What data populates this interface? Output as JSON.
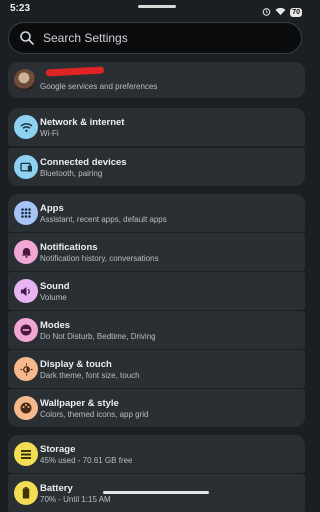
{
  "status_bar": {
    "time": "5:23",
    "alarm_icon": "alarm-icon",
    "wifi_icon": "wifi-icon",
    "battery": "70"
  },
  "search": {
    "placeholder": "Search Settings"
  },
  "account": {
    "name": "",
    "subtitle": "Google services and preferences"
  },
  "groups": [
    {
      "items": [
        {
          "title": "Network & internet",
          "subtitle": "Wi-Fi",
          "icon": "wifi-icon",
          "color": "#8fd1f2"
        },
        {
          "title": "Connected devices",
          "subtitle": "Bluetooth, pairing",
          "icon": "devices-icon",
          "color": "#8fd1f2"
        }
      ]
    },
    {
      "items": [
        {
          "title": "Apps",
          "subtitle": "Assistant, recent apps, default apps",
          "icon": "apps-icon",
          "color": "#a8c4f6"
        },
        {
          "title": "Notifications",
          "subtitle": "Notification history, conversations",
          "icon": "bell-icon",
          "color": "#f0a7d6"
        },
        {
          "title": "Sound",
          "subtitle": "Volume",
          "icon": "volume-icon",
          "color": "#e9b3f3"
        },
        {
          "title": "Modes",
          "subtitle": "Do Not Disturb, Bedtime, Driving",
          "icon": "do-not-disturb-icon",
          "color": "#f0a7d6"
        },
        {
          "title": "Display & touch",
          "subtitle": "Dark theme, font size, touch",
          "icon": "brightness-icon",
          "color": "#f5b98d"
        },
        {
          "title": "Wallpaper & style",
          "subtitle": "Colors, themed icons, app grid",
          "icon": "palette-icon",
          "color": "#f5b98d"
        }
      ]
    },
    {
      "items": [
        {
          "title": "Storage",
          "subtitle": "45% used - 70.61 GB free",
          "icon": "storage-icon",
          "color": "#f2dd55"
        },
        {
          "title": "Battery",
          "subtitle": "70% - Until 1:15 AM",
          "icon": "battery-icon",
          "color": "#f2dd55"
        }
      ]
    }
  ]
}
